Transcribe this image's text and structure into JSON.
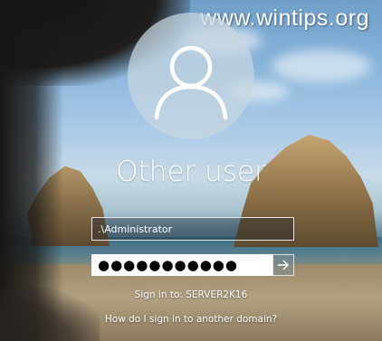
{
  "watermark": {
    "text": "www.wintips.org"
  },
  "user": {
    "display_name": "Other user",
    "avatar_icon": "user-silhouette-icon"
  },
  "login_form": {
    "username_value": ".\\Administrator",
    "password_value": "●●●●●●●●●●●",
    "submit_icon": "arrow-right-icon",
    "sign_in_to_text": "Sign in to: SERVER2K16",
    "other_domain_link": "How do I sign in to another domain?"
  },
  "colors": {
    "text": "#ffffff",
    "field_border": "#e6e6e6",
    "avatar_bg": "#c8d7e1"
  }
}
